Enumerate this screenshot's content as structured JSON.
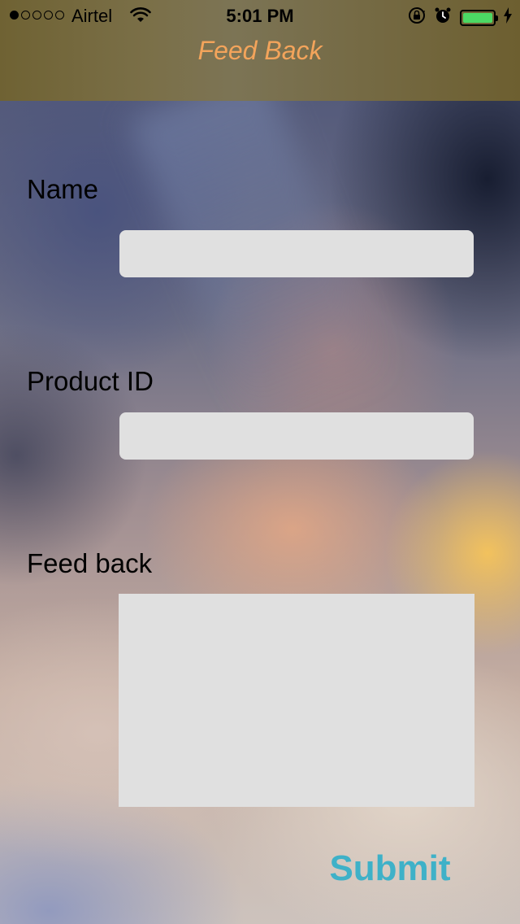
{
  "status_bar": {
    "signal_dots": [
      true,
      false,
      false,
      false,
      false
    ],
    "carrier": "Airtel",
    "time": "5:01 PM",
    "icons": [
      "wifi-icon",
      "orientation-lock-icon",
      "alarm-icon",
      "battery-icon",
      "charging-bolt-icon"
    ],
    "battery_level": 1.0,
    "battery_color": "#4cd964"
  },
  "nav": {
    "title": "Feed Back",
    "title_color": "#f3a45b"
  },
  "form": {
    "name_label": "Name",
    "name_value": "",
    "product_label": "Product ID",
    "product_value": "",
    "feedback_label": "Feed back",
    "feedback_value": "",
    "submit_label": "Submit",
    "submit_color": "#3eb1c8"
  }
}
